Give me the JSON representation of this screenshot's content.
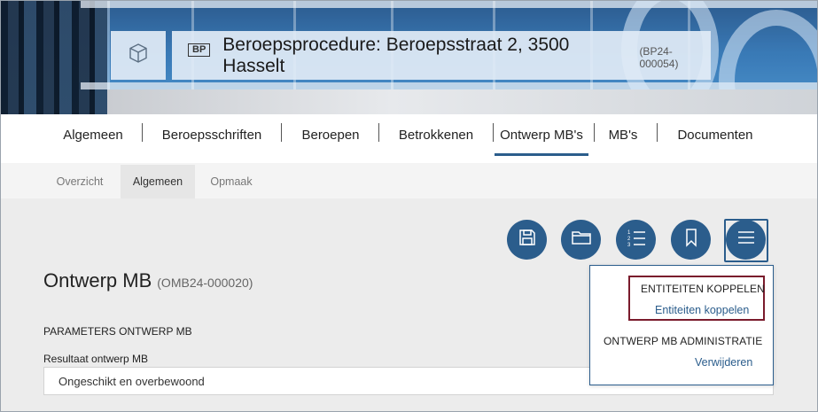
{
  "header": {
    "tag": "BP",
    "title": "Beroepsprocedure: Beroepsstraat 2, 3500 Hasselt",
    "code": "(BP24-000054)",
    "logo_icon": "cube-icon"
  },
  "main_tabs": [
    {
      "label": "Algemeen"
    },
    {
      "label": "Beroepsschriften"
    },
    {
      "label": "Beroepen"
    },
    {
      "label": "Betrokkenen"
    },
    {
      "label": "Ontwerp MB's",
      "active": true
    },
    {
      "label": "MB's"
    },
    {
      "label": "Documenten"
    }
  ],
  "sub_tabs": [
    {
      "label": "Overzicht"
    },
    {
      "label": "Algemeen",
      "active": true
    },
    {
      "label": "Opmaak"
    }
  ],
  "actions": [
    {
      "icon": "save-icon"
    },
    {
      "icon": "folder-icon"
    },
    {
      "icon": "numbered-list-icon"
    },
    {
      "icon": "bookmark-icon"
    },
    {
      "icon": "menu-icon",
      "active": true
    }
  ],
  "page": {
    "title": "Ontwerp MB",
    "code": "(OMB24-000020)",
    "section_title": "PARAMETERS ONTWERP MB",
    "field_label": "Resultaat ontwerp MB",
    "field_value": "Ongeschikt en overbewoond"
  },
  "dropdown": {
    "group1_heading": "ENTITEITEN KOPPELEN",
    "group1_link": "Entiteiten koppelen",
    "group2_heading": "ONTWERP MB ADMINISTRATIE",
    "group2_link": "Verwijderen"
  },
  "colors": {
    "accent": "#2b5d8c",
    "highlight": "#7a1b2c"
  }
}
